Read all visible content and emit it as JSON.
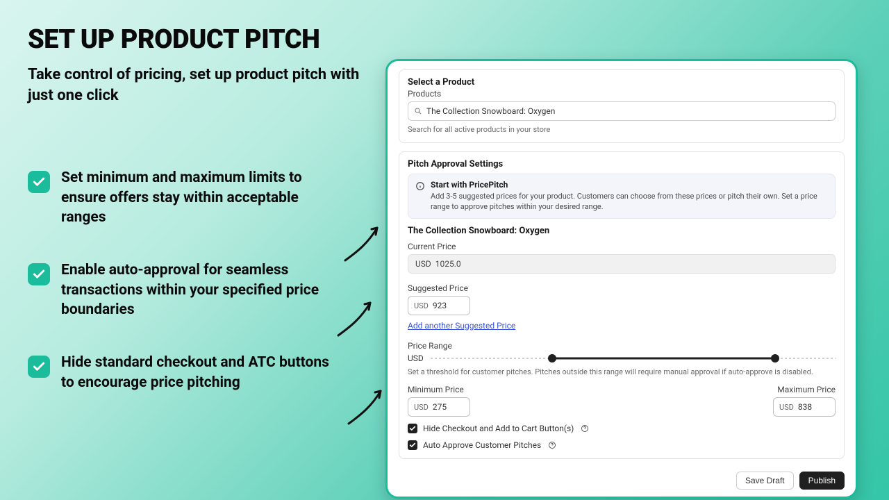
{
  "marketing": {
    "headline": "SET UP PRODUCT PITCH",
    "subhead": "Take control of pricing, set up product pitch with just one click",
    "features": [
      "Set minimum and maximum limits to ensure offers stay within acceptable ranges",
      "Enable auto-approval for seamless transactions within your specified price boundaries",
      "Hide standard checkout and ATC buttons to encourage price pitching"
    ]
  },
  "select": {
    "title": "Select a Product",
    "subtitle": "Products",
    "value": "The Collection Snowboard: Oxygen",
    "hint": "Search for all active products in your store"
  },
  "settings": {
    "title": "Pitch Approval Settings",
    "banner": {
      "title": "Start with PricePitch",
      "desc": "Add 3-5 suggested prices for your product. Customers can choose from these prices or pitch their own. Set a price range to approve pitches within your desired range."
    },
    "product_name": "The Collection Snowboard: Oxygen",
    "current": {
      "label": "Current Price",
      "currency": "USD",
      "value": "1025.0"
    },
    "suggested": {
      "label": "Suggested Price",
      "currency": "USD",
      "value": "923",
      "add_link": "Add another Suggested Price"
    },
    "range": {
      "label": "Price Range",
      "currency": "USD",
      "hint": "Set a threshold for customer pitches. Pitches outside this range will require manual approval if auto-approve is disabled.",
      "min_label": "Minimum Price",
      "min_value": "275",
      "max_label": "Maximum Price",
      "max_value": "838"
    },
    "options": {
      "hide_checkout": "Hide Checkout and Add to Cart Button(s)",
      "auto_approve": "Auto Approve Customer Pitches"
    }
  },
  "footer": {
    "save": "Save Draft",
    "publish": "Publish"
  }
}
